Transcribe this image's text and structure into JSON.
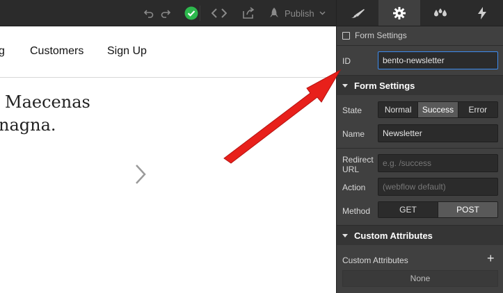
{
  "toolbar": {
    "icons": [
      "undo-icon",
      "redo-icon",
      "check-circle-icon",
      "code-icon",
      "export-icon",
      "rocket-icon"
    ],
    "publish_label": "Publish",
    "colors": {
      "bar": "#2b2b2b",
      "check": "#2db84d"
    }
  },
  "canvas": {
    "nav_partial": "g",
    "nav_customers": "Customers",
    "nav_signup": "Sign Up",
    "hero_line1": "Maecenas",
    "hero_line2": "nagna."
  },
  "panel": {
    "tabs": [
      "brush-icon",
      "gear-icon",
      "drops-icon",
      "bolt-icon"
    ],
    "active_tab": "gear-icon",
    "form_settings_checkbox": "Form Settings",
    "id_label": "ID",
    "id_value": "bento-newsletter",
    "section_form": "Form Settings",
    "state_label": "State",
    "state_options": [
      "Normal",
      "Success",
      "Error"
    ],
    "state_selected": "Success",
    "name_label": "Name",
    "name_value": "Newsletter",
    "redirect_label_1": "Redirect",
    "redirect_label_2": "URL",
    "redirect_placeholder": "e.g. /success",
    "action_label": "Action",
    "action_placeholder": "(webflow default)",
    "method_label": "Method",
    "method_options": [
      "GET",
      "POST"
    ],
    "method_selected": "POST",
    "section_custom": "Custom Attributes",
    "custom_attr_label": "Custom Attributes",
    "custom_attr_empty": "None",
    "colors": {
      "panel": "#404040",
      "focus": "#3d8cf0"
    }
  },
  "annotation": {
    "arrow_color": "#e8201b"
  }
}
